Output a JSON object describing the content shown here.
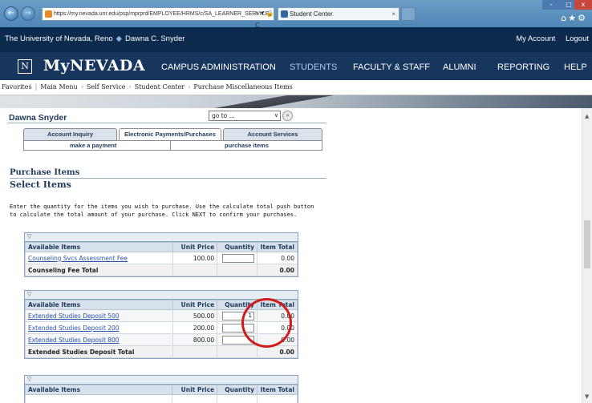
{
  "browser": {
    "url": "https://my.nevada.unr.edu/psp/mprprd/EMPLOYEE/HRMS/c/SA_LEARNER_SERVICE",
    "tab_title": "Student Center",
    "addr_tools": "⌕ ▾ 🔒 C",
    "window_controls": {
      "minimize": "–",
      "maximize": "□",
      "close": "x"
    },
    "icons": [
      "home-icon",
      "star-icon",
      "gear-icon"
    ]
  },
  "topbar": {
    "university": "The University of Nevada, Reno",
    "user": "Dawna C. Snyder",
    "my_account": "My Account",
    "logout": "Logout"
  },
  "mainnav": {
    "logo_glyph": "N",
    "brand": "MyNEVADA",
    "links": [
      "CAMPUS ADMINISTRATION",
      "STUDENTS",
      "FACULTY & STAFF",
      "ALUMNI",
      "REPORTING",
      "HELP"
    ],
    "active": "STUDENTS"
  },
  "breadcrumb": {
    "favorites": "Favorites",
    "main_menu": "Main Menu",
    "self_service": "Self Service",
    "student_center": "Student Center",
    "current": "Purchase Miscellaneous Items"
  },
  "page": {
    "user_name": "Dawna Snyder",
    "goto_value": "go to ...",
    "tabs": [
      "Account Inquiry",
      "Electronic Payments/Purchases",
      "Account Services"
    ],
    "subtabs": [
      "make a payment",
      "purchase items"
    ],
    "heading": "Purchase Items",
    "subheading": "Select Items",
    "instructions": "Enter the quantity for the items you wish to purchase. Use the calculate total push button to calculate the total amount of your purchase. Click NEXT to confirm your purchases."
  },
  "columns": {
    "item": "Available Items",
    "price": "Unit Price",
    "qty": "Quantity",
    "total": "Item Total"
  },
  "grid_counseling": {
    "rows": [
      {
        "item": "Counseling Svcs Assessment Fee",
        "price": "100.00",
        "qty": "",
        "total": "0.00"
      }
    ],
    "total_label": "Counseling Fee Total",
    "total_value": "0.00"
  },
  "grid_extended": {
    "rows": [
      {
        "item": "Extended Studies Deposit 500",
        "price": "500.00",
        "qty": "1",
        "total": "0.00"
      },
      {
        "item": "Extended Studies Deposit 200",
        "price": "200.00",
        "qty": "",
        "total": "0.00"
      },
      {
        "item": "Extended Studies Deposit 800",
        "price": "800.00",
        "qty": "",
        "total": "0.00"
      }
    ],
    "total_label": "Extended Studies Deposit Total",
    "total_value": "0.00"
  },
  "grid_third": {
    "header_glyph": "▽"
  },
  "glyphs": {
    "grid_toggle": "▽",
    "back": "←",
    "forward": "→",
    "dropdown": "∨",
    "go": "»"
  },
  "colors": {
    "nav_bg": "#17365d",
    "top_bg": "#0b2a4d",
    "link": "#2a54a8",
    "annotation": "#d11b1b"
  }
}
